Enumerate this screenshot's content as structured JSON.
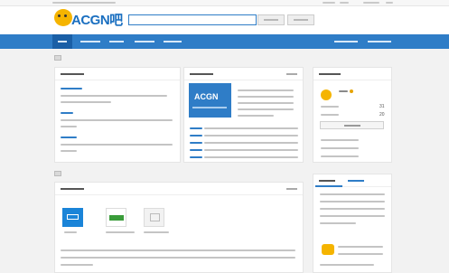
{
  "brand": {
    "logo_text": "ACGN",
    "logo_suffix": "吧"
  },
  "featured": {
    "cover_title": "ACGN"
  },
  "profile": {
    "stats": [
      "31",
      "20"
    ]
  },
  "colors": {
    "primary": "#2f7dc7",
    "nav_active": "#1a5fa6",
    "accent": "#f5b400",
    "background": "#f2f2f2"
  },
  "icons": {
    "logo": "cat-mascot-icon",
    "section_marker": "section-flag-icon",
    "site_tiles": [
      "blue-app-tile-icon",
      "green-app-tile-icon",
      "image-placeholder-icon"
    ],
    "medal": "medal-icon",
    "sticker": "cat-sticker-icon"
  }
}
